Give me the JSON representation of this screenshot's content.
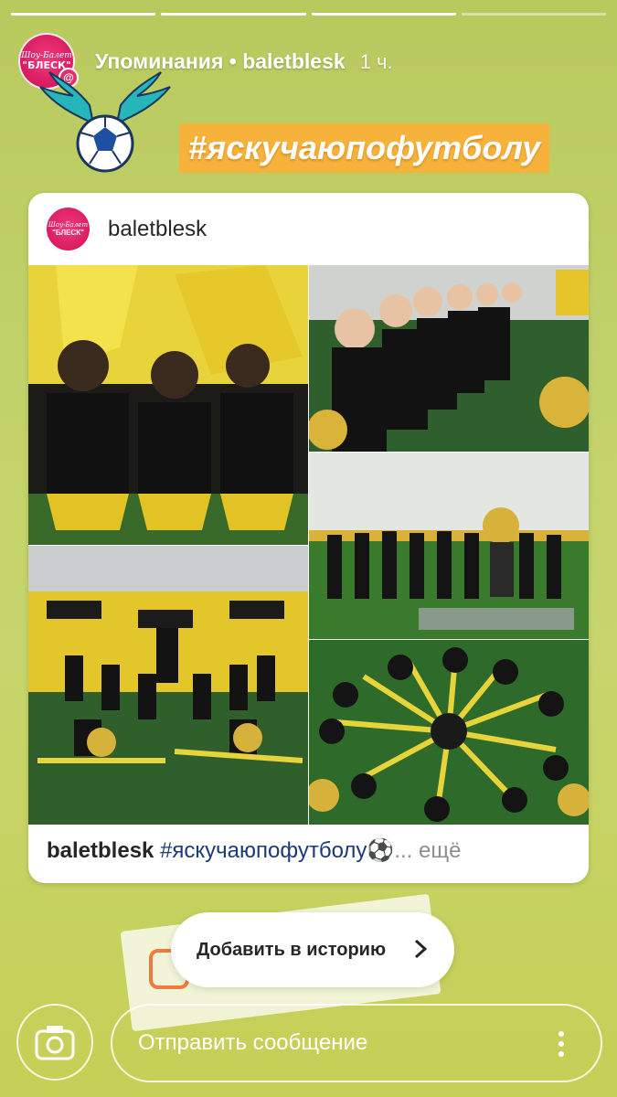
{
  "story": {
    "progress": [
      1,
      1,
      1,
      0
    ],
    "header": {
      "title": "Упоминания • baletblesk",
      "time": "1 ч."
    },
    "avatar": {
      "line1": "Шоу-Балет",
      "line2": "\"БЛЕСК\"",
      "badge": "@"
    },
    "hashtag_sticker": "#яскучаюпофутболу",
    "post": {
      "username": "baletblesk",
      "avatar_line1": "Шоу-Балет",
      "avatar_line2": "\"БЛЕСК\"",
      "caption_user": "baletblesk",
      "caption_tag": "#яскучаюпофутболу",
      "caption_emoji": "⚽",
      "caption_more": "... ещё",
      "photos": [
        "photo-cheerleaders-back-flags",
        "photo-cheerleaders-line-side",
        "photo-cheerleaders-stadium-splits",
        "photo-cheerleaders-mascot-line",
        "photo-cheerleaders-circle-formation"
      ]
    },
    "add_to_story_label": "Добавить в историю",
    "message_placeholder": "Отправить сообщение",
    "colors": {
      "background_top": "#b8c95e",
      "background_bottom": "#c6cf56",
      "hashtag_bg": "#f6b23a",
      "brand_pink": "#d81b60",
      "story_icon": "#f07b3c"
    },
    "icons": [
      "mention-icon",
      "more-icon",
      "chevron-right-icon",
      "camera-icon",
      "kebab-icon",
      "soccer-ball-sticker"
    ]
  }
}
